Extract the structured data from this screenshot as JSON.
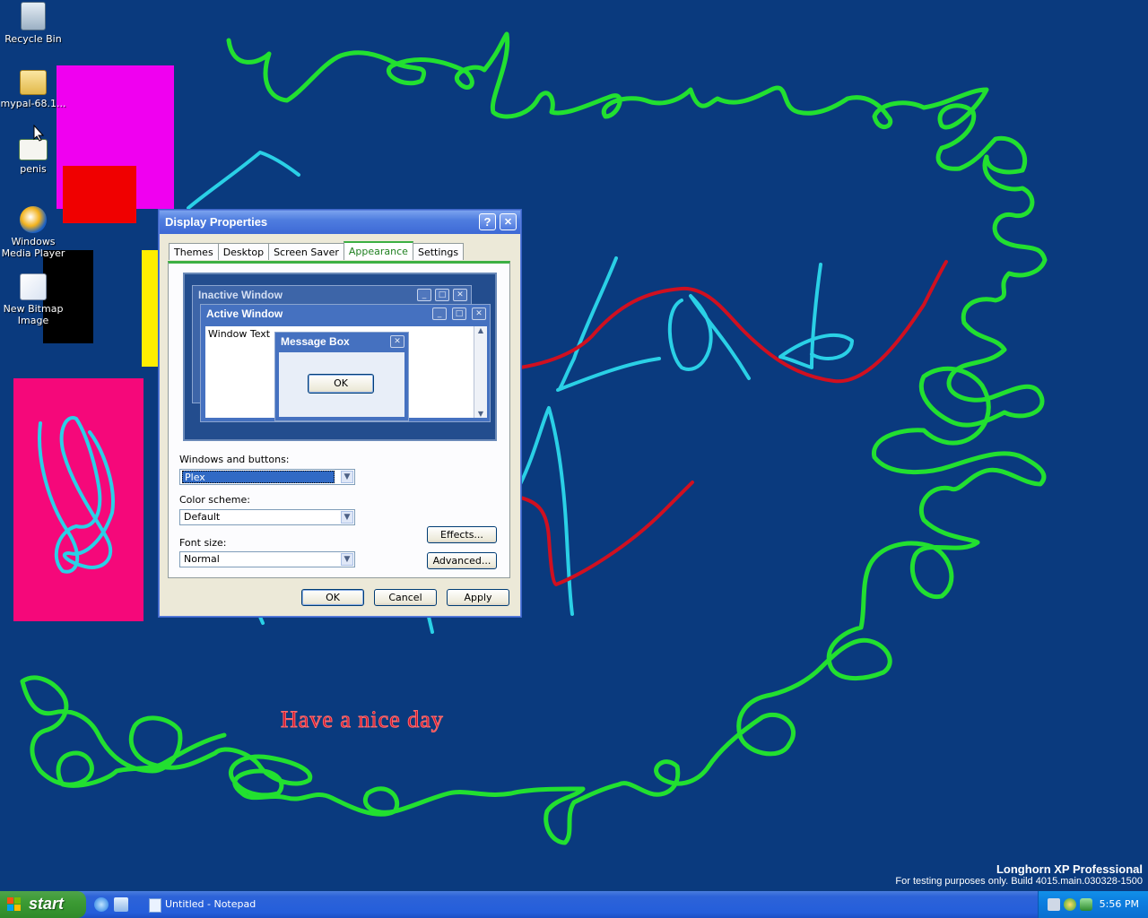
{
  "desktop": {
    "icons": [
      {
        "label": "Recycle Bin",
        "icon": "recycle-bin-icon"
      },
      {
        "label": "mypal-68.1...",
        "icon": "zip-folder-icon"
      },
      {
        "label": "penis",
        "icon": "image-file-icon"
      },
      {
        "label": "Windows Media Player",
        "icon": "media-player-icon"
      },
      {
        "label": "New Bitmap Image",
        "icon": "paint-bitmap-icon"
      }
    ],
    "drawing_text": "Have a nice day",
    "watermark": {
      "title": "Longhorn XP Professional",
      "build": "For testing purposes only. Build 4015.main.030328-1500"
    },
    "colors": {
      "background": "#0a3a7e",
      "green": "#22e030",
      "cyan": "#2ad0e6",
      "red": "#d01020",
      "magenta": "#f000f0",
      "pink": "#f5087a",
      "yellow": "#ffee00"
    }
  },
  "dialog": {
    "title": "Display Properties",
    "help_label": "?",
    "close_label": "✕",
    "tabs": [
      "Themes",
      "Desktop",
      "Screen Saver",
      "Appearance",
      "Settings"
    ],
    "active_tab": "Appearance",
    "preview": {
      "inactive_title": "Inactive Window",
      "active_title": "Active Window",
      "window_text": "Window Text",
      "message_title": "Message Box",
      "ok_label": "OK"
    },
    "windows_buttons_label": "Windows and buttons:",
    "windows_buttons_value": "Plex",
    "color_scheme_label": "Color scheme:",
    "color_scheme_value": "Default",
    "font_size_label": "Font size:",
    "font_size_value": "Normal",
    "effects_label": "Effects...",
    "advanced_label": "Advanced...",
    "ok_label": "OK",
    "cancel_label": "Cancel",
    "apply_label": "Apply"
  },
  "taskbar": {
    "start_label": "start",
    "task_label": "Untitled - Notepad",
    "clock": "5:56 PM"
  }
}
